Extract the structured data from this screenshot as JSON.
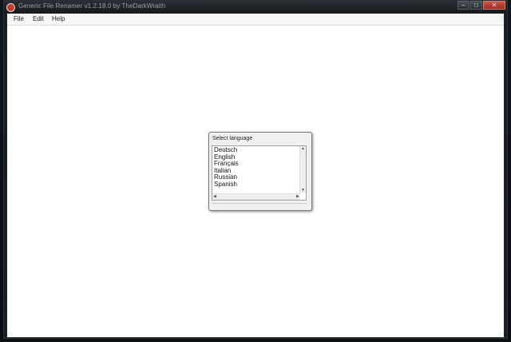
{
  "window": {
    "title": "Generic File Renamer v1.2.18.0 by TheDarkWraith",
    "controls": {
      "minimize": "–",
      "maximize": "□",
      "close": "✕"
    }
  },
  "menu": {
    "items": [
      "File",
      "Edit",
      "Help"
    ]
  },
  "dialog": {
    "title": "Select language",
    "languages": [
      "Deutsch",
      "English",
      "Français",
      "Italian",
      "Russian",
      "Spanish"
    ],
    "scroll_up": "▲",
    "scroll_down": "▼",
    "scroll_left": "◀",
    "scroll_right": "▶"
  },
  "colors": {
    "close_button": "#c9584a",
    "client_background": "#ffffff",
    "dialog_background": "#f0f0f0"
  }
}
